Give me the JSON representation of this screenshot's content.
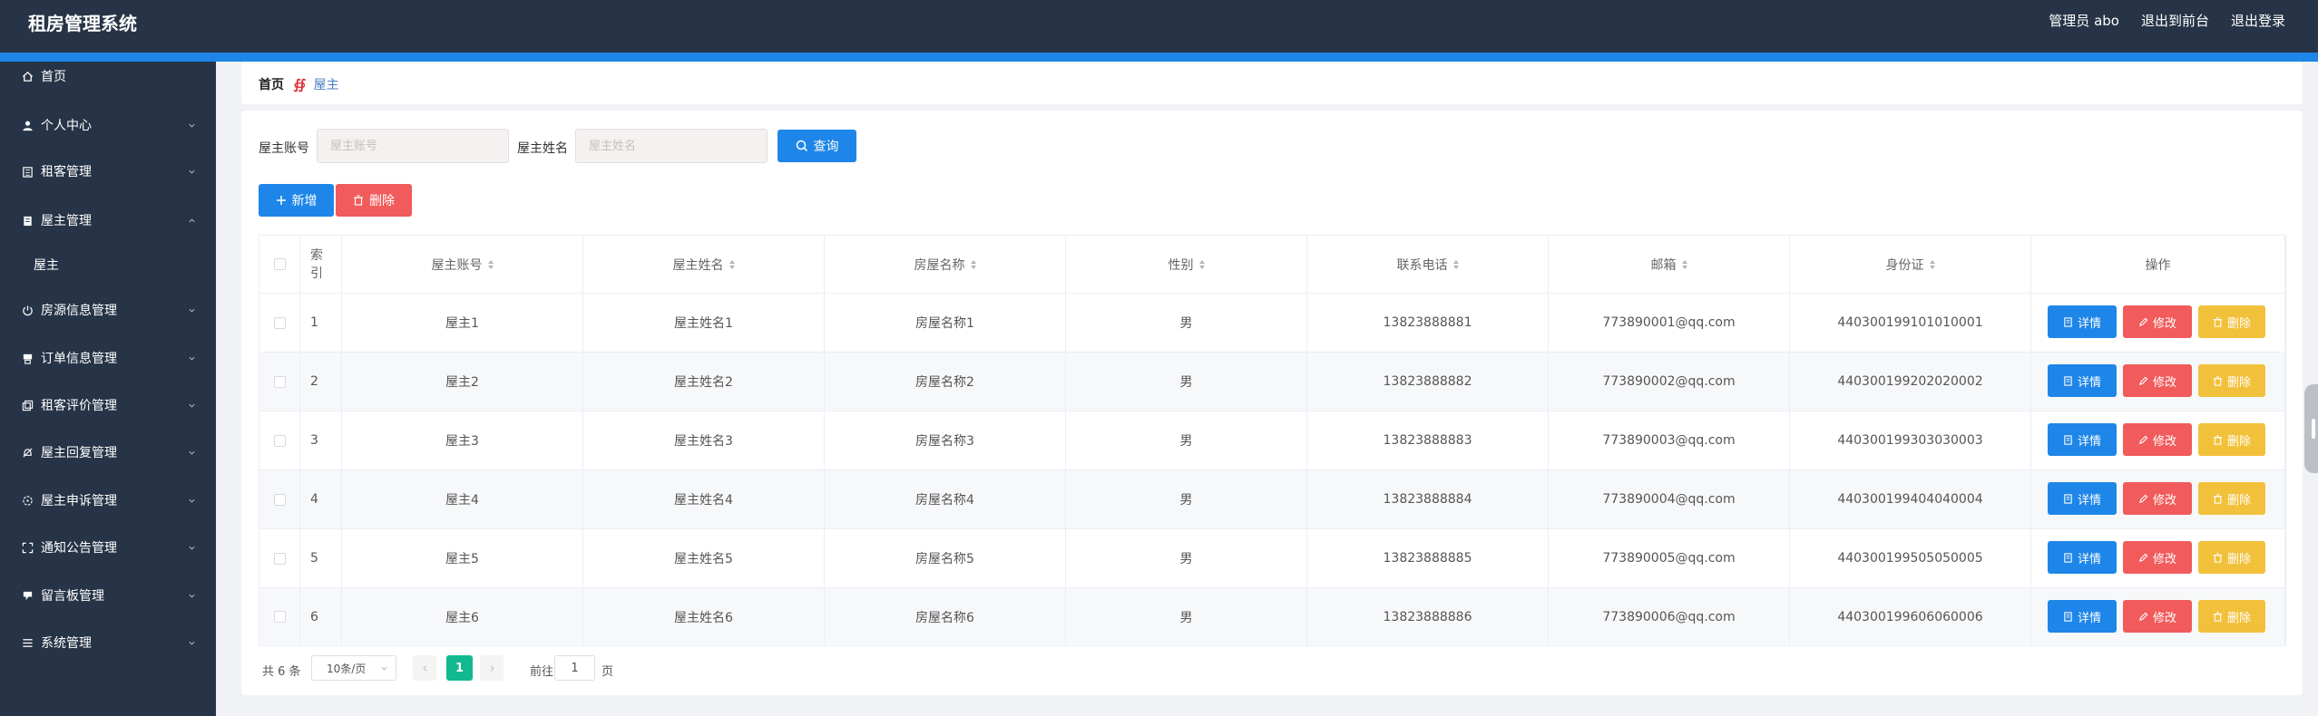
{
  "header": {
    "title": "租房管理系统",
    "user": "管理员 abo",
    "front_link": "退出到前台",
    "logout": "退出登录"
  },
  "sidebar": {
    "items": [
      {
        "label": "首页",
        "icon": "home-icon",
        "expandable": false
      },
      {
        "label": "个人中心",
        "icon": "user-icon",
        "expandable": true
      },
      {
        "label": "租客管理",
        "icon": "building-icon",
        "expandable": true
      },
      {
        "label": "屋主管理",
        "icon": "clipboard-icon",
        "expandable": true,
        "expanded": true
      },
      {
        "label": "房源信息管理",
        "icon": "power-icon",
        "expandable": true
      },
      {
        "label": "订单信息管理",
        "icon": "printer-icon",
        "expandable": true
      },
      {
        "label": "租客评价管理",
        "icon": "copy-icon",
        "expandable": true
      },
      {
        "label": "屋主回复管理",
        "icon": "bell-off-icon",
        "expandable": true
      },
      {
        "label": "屋主申诉管理",
        "icon": "aim-icon",
        "expandable": true
      },
      {
        "label": "通知公告管理",
        "icon": "fullscreen-icon",
        "expandable": true
      },
      {
        "label": "留言板管理",
        "icon": "chat-icon",
        "expandable": true
      },
      {
        "label": "系统管理",
        "icon": "menu-icon",
        "expandable": true
      }
    ],
    "sub_item": "屋主"
  },
  "breadcrumb": {
    "home": "首页",
    "separator": "∯",
    "current": "屋主"
  },
  "search": {
    "account_label": "屋主账号",
    "account_placeholder": "屋主账号",
    "name_label": "屋主姓名",
    "name_placeholder": "屋主姓名",
    "query_button": "查询"
  },
  "actions": {
    "add": "新增",
    "delete": "删除"
  },
  "table": {
    "columns": [
      "索引",
      "屋主账号",
      "屋主姓名",
      "房屋名称",
      "性别",
      "联系电话",
      "邮箱",
      "身份证",
      "操作"
    ],
    "rows": [
      [
        "1",
        "屋主1",
        "屋主姓名1",
        "房屋名称1",
        "男",
        "13823888881",
        "773890001@qq.com",
        "440300199101010001"
      ],
      [
        "2",
        "屋主2",
        "屋主姓名2",
        "房屋名称2",
        "男",
        "13823888882",
        "773890002@qq.com",
        "440300199202020002"
      ],
      [
        "3",
        "屋主3",
        "屋主姓名3",
        "房屋名称3",
        "男",
        "13823888883",
        "773890003@qq.com",
        "440300199303030003"
      ],
      [
        "4",
        "屋主4",
        "屋主姓名4",
        "房屋名称4",
        "男",
        "13823888884",
        "773890004@qq.com",
        "440300199404040004"
      ],
      [
        "5",
        "屋主5",
        "屋主姓名5",
        "房屋名称5",
        "男",
        "13823888885",
        "773890005@qq.com",
        "440300199505050005"
      ],
      [
        "6",
        "屋主6",
        "屋主姓名6",
        "房屋名称6",
        "男",
        "13823888886",
        "773890006@qq.com",
        "440300199606060006"
      ]
    ],
    "row_actions": {
      "detail": "详情",
      "edit": "修改",
      "delete": "删除"
    }
  },
  "pagination": {
    "total": "共 6 条",
    "page_size": "10条/页",
    "current_page": "1",
    "goto_label": "前往",
    "goto_value": "1",
    "page_suffix": "页"
  },
  "colors": {
    "header_bg": "#273447",
    "accent_blue": "#1e86e8",
    "danger_red": "#f15b5b",
    "warning_yellow": "#f2c13b",
    "page_active": "#12b890"
  }
}
